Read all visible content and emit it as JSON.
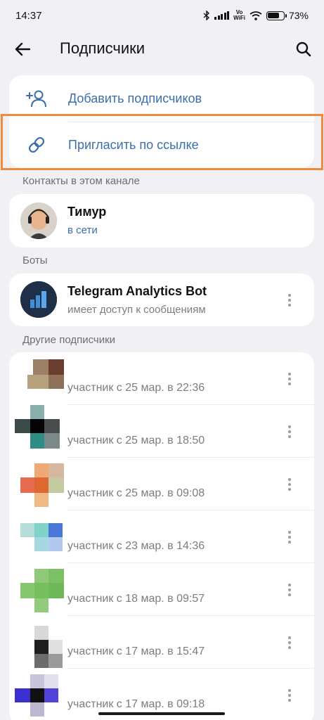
{
  "status_bar": {
    "time": "14:37",
    "network": "Vo WiFi",
    "battery": "73%",
    "battery_level": 0.73
  },
  "header": {
    "title": "Подписчики"
  },
  "actions": [
    {
      "label": "Добавить подписчиков",
      "icon": "add-person-icon"
    },
    {
      "label": "Пригласить по ссылке",
      "icon": "link-icon"
    }
  ],
  "sections": {
    "contacts": "Контакты в этом канале",
    "bots": "Боты",
    "others": "Другие подписчики"
  },
  "contact": {
    "name": "Тимур",
    "status": "в сети",
    "status_color": "#3b6fa8"
  },
  "bot": {
    "name": "Telegram Analytics Bot",
    "status": "имеет доступ к сообщениям"
  },
  "members": [
    {
      "joined": "участник с 25 мар. в 22:36"
    },
    {
      "joined": "участник с 25 мар. в 18:50"
    },
    {
      "joined": "участник с 25 мар. в 09:08"
    },
    {
      "joined": "участник с 23 мар. в 14:36"
    },
    {
      "joined": "участник с 18 мар. в 09:57"
    },
    {
      "joined": "участник с 17 мар. в 15:47"
    },
    {
      "joined": "участник с 17 мар. в 09:18"
    }
  ],
  "colors": {
    "accent": "#3b6fa8",
    "highlight": "#f08a3c",
    "background": "#f0f0f5"
  }
}
